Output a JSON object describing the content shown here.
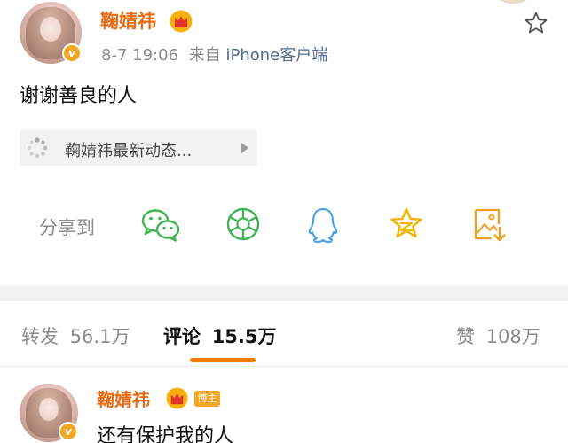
{
  "post": {
    "author_name": "鞠婧祎",
    "timestamp": "8-7 19:06",
    "source_prefix": "来自",
    "source_client": "iPhone客户端",
    "text": "谢谢善良的人"
  },
  "topic_card": {
    "label": "鞠婧祎最新动态..."
  },
  "share": {
    "label": "分享到",
    "targets": [
      "wechat-icon",
      "moments-icon",
      "qq-icon",
      "qzone-icon",
      "save-image-icon"
    ]
  },
  "tabs": [
    {
      "label": "转发",
      "count": "56.1万",
      "active": false
    },
    {
      "label": "评论",
      "count": "15.5万",
      "active": true
    },
    {
      "label": "赞",
      "count": "108万",
      "active": false
    }
  ],
  "comment": {
    "author_name": "鞠婧祎",
    "badge": "博主",
    "text": "还有保护我的人"
  },
  "colors": {
    "name": "#e86b12",
    "accent": "#f57c00",
    "badge": "#f5a623",
    "wechat": "#3fb553",
    "qq": "#4aa3e6",
    "qzone": "#f5b400"
  }
}
